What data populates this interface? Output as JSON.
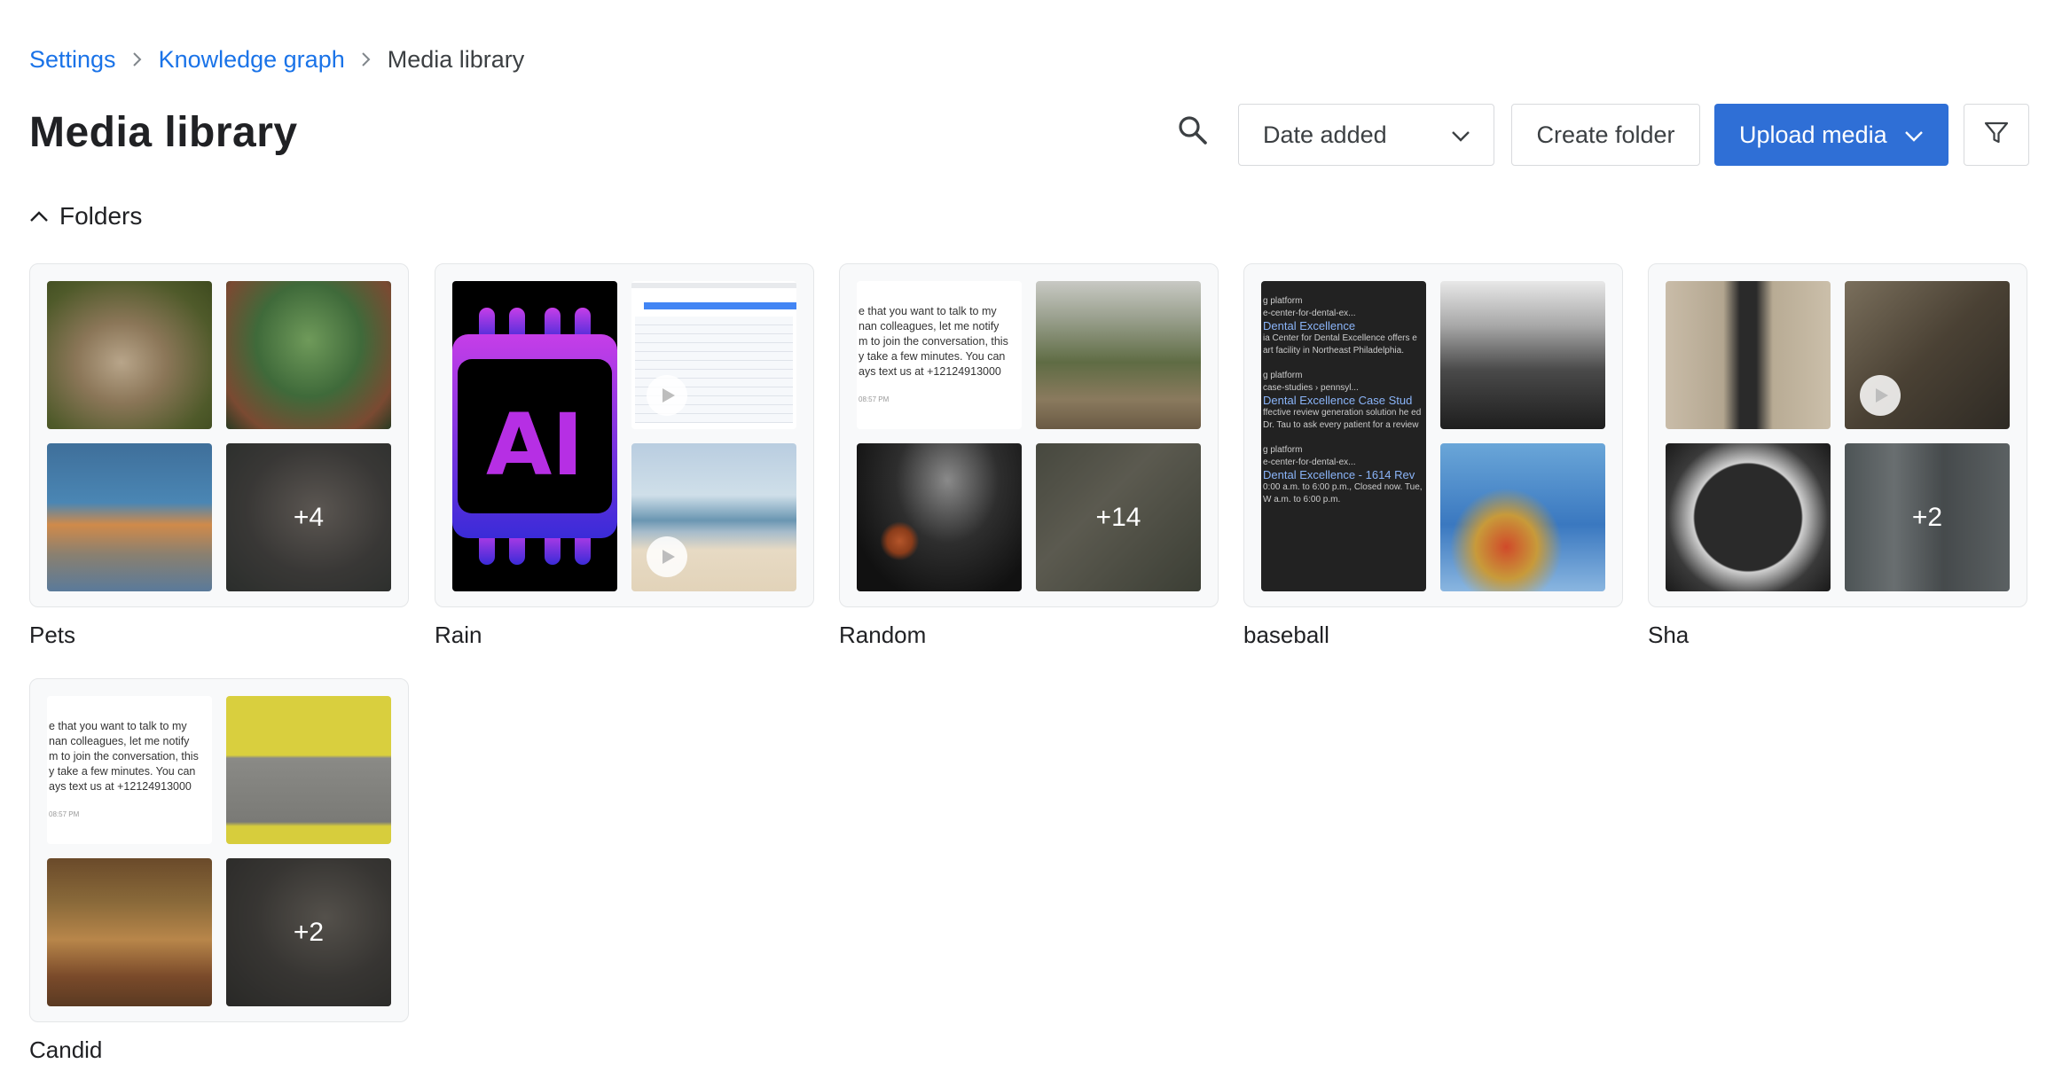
{
  "breadcrumb": {
    "items": [
      {
        "label": "Settings"
      },
      {
        "label": "Knowledge graph"
      },
      {
        "label": "Media library"
      }
    ]
  },
  "header": {
    "title": "Media library",
    "sort_select": {
      "value": "Date added"
    },
    "create_folder_label": "Create folder",
    "upload_label": "Upload media"
  },
  "folders_section": {
    "label": "Folders"
  },
  "folders": [
    {
      "name": "Pets",
      "more": "+4"
    },
    {
      "name": "Rain"
    },
    {
      "name": "Random",
      "more": "+14",
      "text_preview": [
        "e that you want to talk to my",
        "nan colleagues, let me notify",
        "m to join the conversation, this",
        "y take a few minutes. You can",
        "ays text us at +12124913000"
      ],
      "text_time": "08:57 PM"
    },
    {
      "name": "baseball",
      "dark_preview": [
        {
          "small1": "g platform",
          "small2": "e-center-for-dental-ex...",
          "link": "Dental Excellence",
          "desc": "ia Center for Dental Excellence offers e art facility in Northeast Philadelphia."
        },
        {
          "small1": "g platform",
          "small2": "case-studies › pennsyl...",
          "link": "Dental Excellence Case Stud",
          "desc": "ffective review generation solution he ed Dr. Tau to ask every patient for a review"
        },
        {
          "small1": "g platform",
          "small2": "e-center-for-dental-ex...",
          "link": "Dental Excellence - 1614 Rev",
          "desc": "0:00 a.m. to 6:00 p.m., Closed now. Tue, W a.m. to 6:00 p.m."
        }
      ]
    },
    {
      "name": "Sha",
      "more": "+2"
    },
    {
      "name": "Candid",
      "more": "+2",
      "text_preview": [
        "e that you want to talk to my",
        "nan colleagues, let me notify",
        "m to join the conversation, this",
        "y take a few minutes. You can",
        "ays text us at +12124913000"
      ],
      "text_time": "08:57 PM"
    }
  ],
  "thumb_ai_text": "AI",
  "colors": {
    "accent": "#2f6fd6",
    "link": "#1a73e8",
    "border": "#d8dadd"
  },
  "icons": [
    "chevron-right-icon",
    "search-icon",
    "chevron-down-icon",
    "filter-icon",
    "chevron-up-icon",
    "play-icon"
  ]
}
